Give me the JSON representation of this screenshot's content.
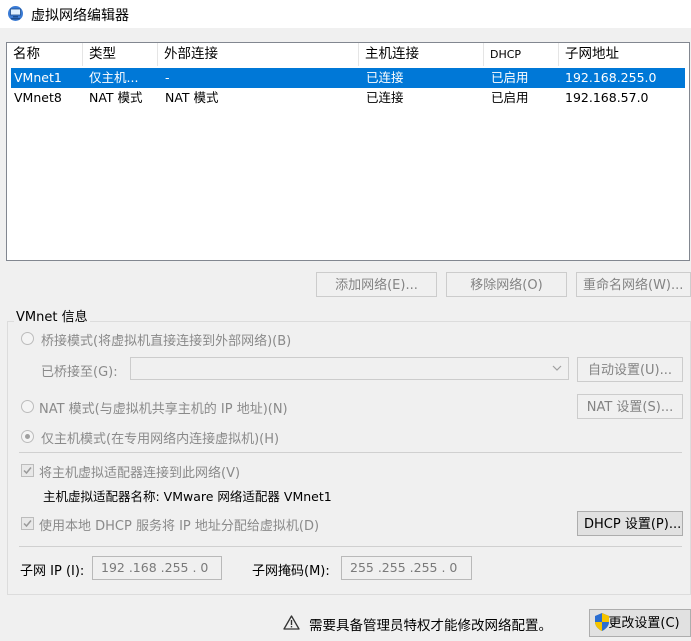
{
  "window": {
    "title": "虚拟网络编辑器"
  },
  "list": {
    "columns": [
      "名称",
      "类型",
      "外部连接",
      "主机连接",
      "DHCP",
      "子网地址"
    ],
    "rows": [
      {
        "name": "VMnet1",
        "type": "仅主机...",
        "external": "-",
        "host": "已连接",
        "dhcp": "已启用",
        "subnet": "192.168.255.0",
        "selected": true
      },
      {
        "name": "VMnet8",
        "type": "NAT 模式",
        "external": "NAT 模式",
        "host": "已连接",
        "dhcp": "已启用",
        "subnet": "192.168.57.0",
        "selected": false
      }
    ]
  },
  "buttons": {
    "add_network": "添加网络(E)...",
    "remove_network": "移除网络(O)",
    "rename_network": "重命名网络(W)..."
  },
  "vmnet_info": {
    "title": "VMnet 信息",
    "bridged_label": "桥接模式(将虚拟机直接连接到外部网络)(B)",
    "bridged_to_label": "已桥接至(G):",
    "bridged_to_value": "",
    "auto_settings": "自动设置(U)...",
    "nat_label": "NAT 模式(与虚拟机共享主机的 IP 地址)(N)",
    "nat_settings": "NAT 设置(S)...",
    "host_only_label": "仅主机模式(在专用网络内连接虚拟机)(H)",
    "connect_adapter_label": "将主机虚拟适配器连接到此网络(V)",
    "adapter_name_label": "主机虚拟适配器名称: VMware 网络适配器 VMnet1",
    "dhcp_label": "使用本地 DHCP 服务将 IP 地址分配给虚拟机(D)",
    "dhcp_settings": "DHCP 设置(P)...",
    "subnet_ip_label": "子网 IP (I):",
    "subnet_ip_value": "192 .168 .255 . 0",
    "subnet_mask_label": "子网掩码(M):",
    "subnet_mask_value": "255 .255 .255 . 0",
    "selected_mode": "host-only"
  },
  "footer": {
    "warning": "需要具备管理员特权才能修改网络配置。",
    "change_settings": "更改设置(C)"
  },
  "colors": {
    "selection": "#0078d7",
    "warning": "#333333",
    "shield_blue": "#2b6ed1",
    "shield_yellow": "#f5c400"
  }
}
